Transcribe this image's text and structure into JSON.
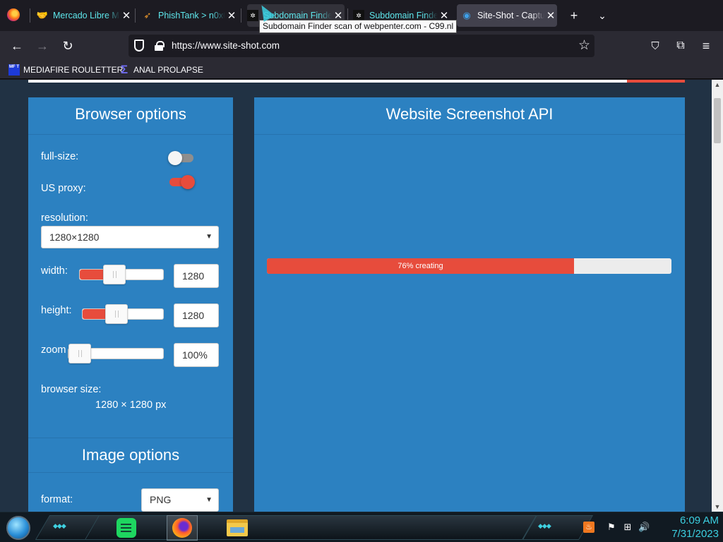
{
  "tabs": [
    {
      "title": "Mercado Libre M",
      "favicon": "handshake-icon",
      "active": false
    },
    {
      "title": "PhishTank > n0x0",
      "favicon": "fish-icon",
      "active": false
    },
    {
      "title": "Subdomain Finde",
      "favicon": "c99-icon",
      "active": false
    },
    {
      "title": "Subdomain Finde",
      "favicon": "c99-icon",
      "active": false
    },
    {
      "title": "Site-Shot - Captu",
      "favicon": "camera-icon",
      "active": true
    }
  ],
  "tooltip": "Subdomain Finder scan of webpenter.com - C99.nl",
  "url": "https://www.site-shot.com",
  "bookmarks": [
    {
      "label": "MEDIAFIRE ROULETTER",
      "icon": "mediafire-icon",
      "icon_text": "MF T"
    },
    {
      "label": "ANAL PROLAPSE",
      "icon": "sigma-icon"
    }
  ],
  "browser_options": {
    "heading": "Browser options",
    "full_size_label": "full-size:",
    "full_size_on": false,
    "us_proxy_label": "US proxy:",
    "us_proxy_on": true,
    "resolution_label": "resolution:",
    "resolution_value": "1280×1280",
    "width_label": "width:",
    "width_value": "1280",
    "height_label": "height:",
    "height_value": "1280",
    "zoom_label": "zoom",
    "zoom_value": "100%",
    "browser_size_label": "browser size:",
    "browser_size_value": "1280 × 1280 px"
  },
  "image_options": {
    "heading": "Image options",
    "format_label": "format:",
    "format_value": "PNG"
  },
  "api_panel": {
    "heading": "Website Screenshot API",
    "progress_percent": 76,
    "progress_label": "76% creating"
  },
  "taskbar": {
    "time": "6:09 AM",
    "date": "7/31/2023"
  },
  "colors": {
    "panel": "#2c81c1",
    "accent_red": "#e74c3c",
    "page_bg": "#213244",
    "clock": "#3ccfe0"
  }
}
